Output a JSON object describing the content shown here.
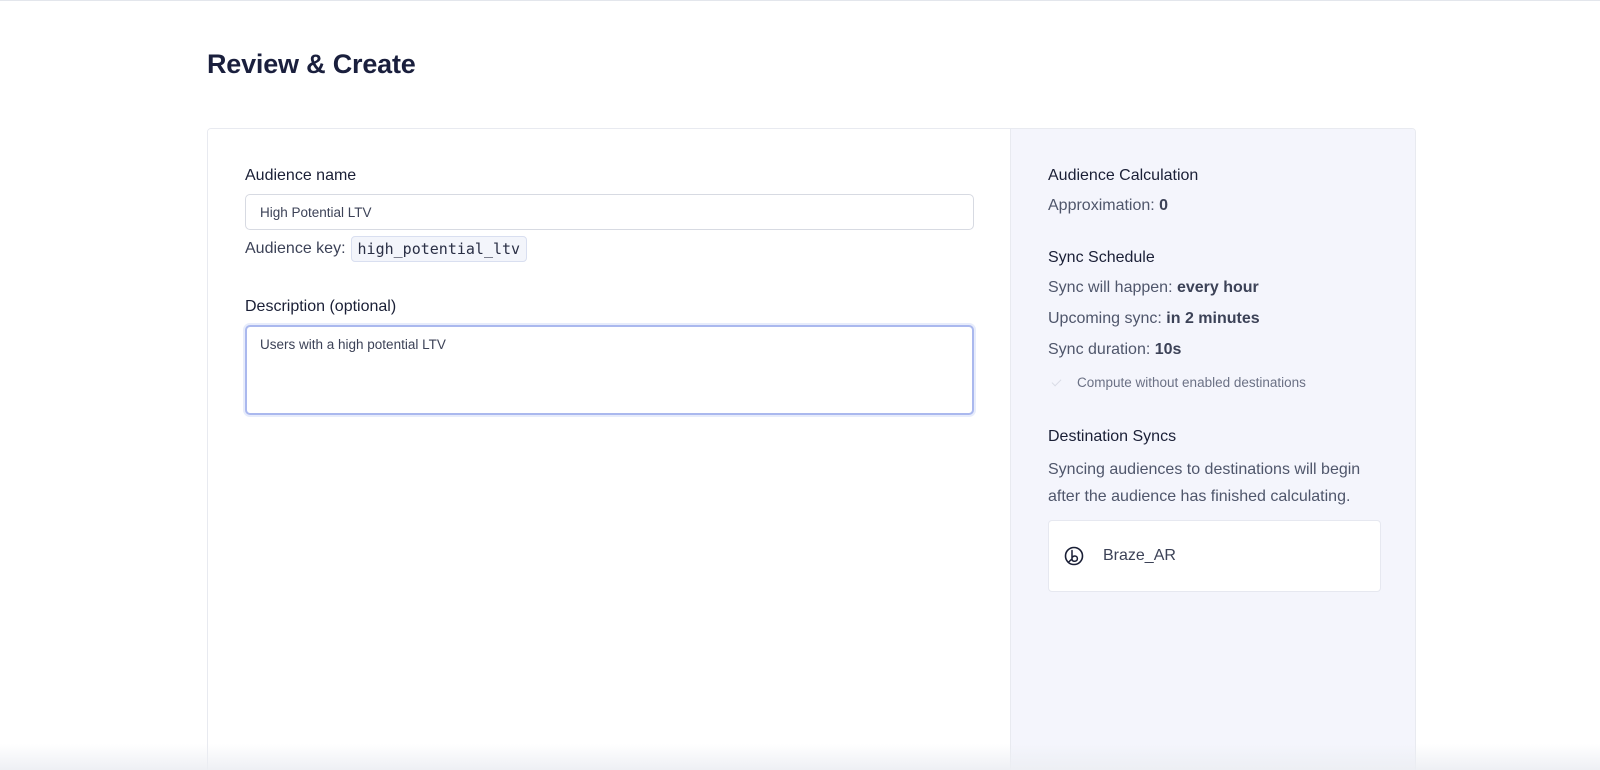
{
  "page": {
    "title": "Review & Create"
  },
  "form": {
    "name_label": "Audience name",
    "name_value": "High Potential LTV",
    "key_label": "Audience key:",
    "key_value": "high_potential_ltv",
    "description_label": "Description (optional)",
    "description_value": "Users with a high potential LTV"
  },
  "sidebar": {
    "calculation": {
      "heading": "Audience Calculation",
      "approx_label": "Approximation:",
      "approx_value": "0"
    },
    "schedule": {
      "heading": "Sync Schedule",
      "frequency_label": "Sync will happen:",
      "frequency_value": "every hour",
      "upcoming_label": "Upcoming sync:",
      "upcoming_value": "in 2 minutes",
      "duration_label": "Sync duration:",
      "duration_value": "10s",
      "compute_label": "Compute without enabled destinations",
      "compute_checked": true
    },
    "destinations": {
      "heading": "Destination Syncs",
      "description": "Syncing audiences to destinations will begin after the audience has finished calculating.",
      "items": [
        {
          "name": "Braze_AR",
          "icon": "braze-icon"
        }
      ]
    }
  },
  "colors": {
    "title": "#1a1f3d",
    "sidebar_bg": "#f4f5fc",
    "focus_border": "#aab8ee",
    "text_muted": "#4f566b"
  }
}
